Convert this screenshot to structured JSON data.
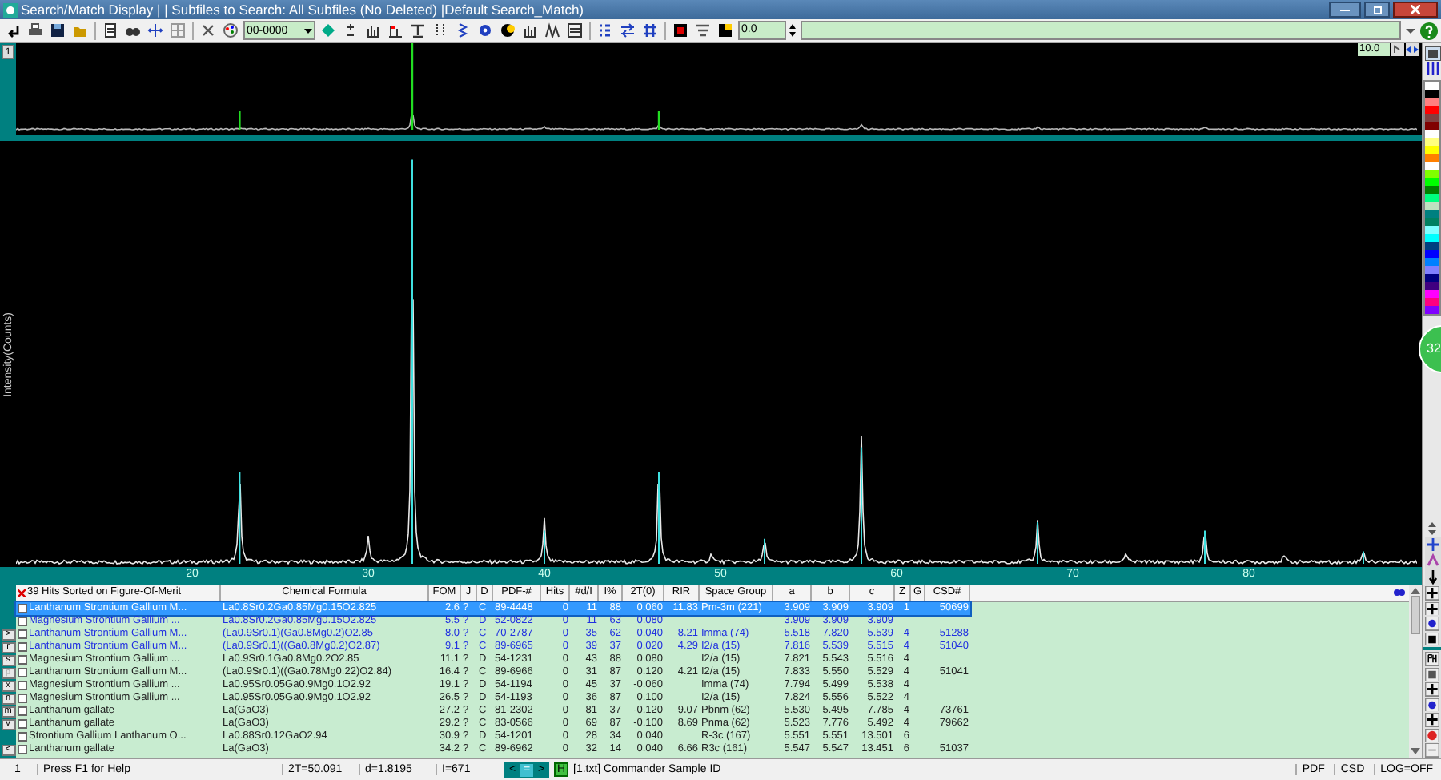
{
  "window": {
    "title": "Search/Match Display | | Subfiles to Search: All Subfiles (No Deleted) |Default Search_Match)"
  },
  "toolbar": {
    "pdf_combo": "00-0000",
    "offset_field": "0.0"
  },
  "upper_plot": {
    "pane_button": "1",
    "scale_field": "10.0"
  },
  "main_plot": {
    "ylabel": "Intensity(Counts)",
    "x_axis_labels": [
      "20",
      "30",
      "40",
      "50",
      "60",
      "70",
      "80"
    ],
    "badge": "32"
  },
  "palette": [
    {
      "color": "#ffffff"
    },
    {
      "color": "#000000"
    },
    {
      "color": "#ff8080"
    },
    {
      "color": "#ff0000"
    },
    {
      "color": "#804040"
    },
    {
      "color": "#800000"
    },
    {
      "color": "#ffffff"
    },
    {
      "color": "#ffff80"
    },
    {
      "color": "#ffff00"
    },
    {
      "color": "#ff8000"
    },
    {
      "color": "#ffffff"
    },
    {
      "color": "#80ff00"
    },
    {
      "color": "#00ff00"
    },
    {
      "color": "#008000"
    },
    {
      "color": "#00ff80"
    },
    {
      "color": "#c0e0c0"
    },
    {
      "color": "#008080"
    },
    {
      "color": "#008060"
    },
    {
      "color": "#80ffff"
    },
    {
      "color": "#00ffff"
    },
    {
      "color": "#004080"
    },
    {
      "color": "#0000ff"
    },
    {
      "color": "#0080ff"
    },
    {
      "color": "#8080ff"
    },
    {
      "color": "#000080"
    },
    {
      "color": "#400080"
    },
    {
      "color": "#ff00ff"
    },
    {
      "color": "#ff0080"
    },
    {
      "color": "#8000ff"
    }
  ],
  "side_buttons": [
    ">",
    "r",
    "s",
    "p",
    "x",
    "n",
    "m",
    "v",
    "<"
  ],
  "table": {
    "columns": [
      "39 Hits Sorted on Figure-Of-Merit",
      "Chemical Formula",
      "FOM",
      "J",
      "D",
      "PDF-#",
      "Hits",
      "#d/I",
      "I%",
      "2T(0)",
      "RIR",
      "Space Group",
      "a",
      "b",
      "c",
      "Z",
      "G",
      "CSD#"
    ],
    "rows": [
      {
        "selected": true,
        "highlighted": true,
        "checked": false,
        "cells": [
          "Lanthanum Strontium Gallium M...",
          "La0.8Sr0.2Ga0.85Mg0.15O2.825",
          "2.6",
          "?",
          "C",
          "89-4448",
          "0",
          "11",
          "88",
          "0.060",
          "11.83",
          "Pm-3m (221)",
          "3.909",
          "3.909",
          "3.909",
          "1",
          "",
          "50699"
        ]
      },
      {
        "selected": false,
        "highlighted": true,
        "checked": false,
        "cells": [
          "Magnesium Strontium Gallium ...",
          "La0.8Sr0.2Ga0.85Mg0.15O2.825",
          "5.5",
          "?",
          "D",
          "52-0822",
          "0",
          "11",
          "63",
          "0.080",
          "",
          "",
          "3.909",
          "3.909",
          "3.909",
          "",
          "",
          ""
        ]
      },
      {
        "selected": false,
        "highlighted": true,
        "checked": false,
        "cells": [
          "Lanthanum Strontium Gallium M...",
          "(La0.9Sr0.1)(Ga0.8Mg0.2)O2.85",
          "8.0",
          "?",
          "C",
          "70-2787",
          "0",
          "35",
          "62",
          "0.040",
          "8.21",
          "Imma (74)",
          "5.518",
          "7.820",
          "5.539",
          "4",
          "",
          "51288"
        ]
      },
      {
        "selected": false,
        "highlighted": true,
        "checked": false,
        "cells": [
          "Lanthanum Strontium Gallium M...",
          "(La0.9Sr0.1)((Ga0.8Mg0.2)O2.87)",
          "9.1",
          "?",
          "C",
          "89-6965",
          "0",
          "39",
          "37",
          "0.020",
          "4.29",
          "I2/a (15)",
          "7.816",
          "5.539",
          "5.515",
          "4",
          "",
          "51040"
        ]
      },
      {
        "selected": false,
        "highlighted": false,
        "checked": false,
        "cells": [
          "Magnesium Strontium Gallium ...",
          "La0.9Sr0.1Ga0.8Mg0.2O2.85",
          "11.1",
          "?",
          "D",
          "54-1231",
          "0",
          "43",
          "88",
          "0.080",
          "",
          "I2/a (15)",
          "7.821",
          "5.543",
          "5.516",
          "4",
          "",
          ""
        ]
      },
      {
        "selected": false,
        "highlighted": false,
        "checked": false,
        "cells": [
          "Lanthanum Strontium Gallium M...",
          "(La0.9Sr0.1)((Ga0.78Mg0.22)O2.84)",
          "16.4",
          "?",
          "C",
          "89-6966",
          "0",
          "31",
          "87",
          "0.120",
          "4.21",
          "I2/a (15)",
          "7.833",
          "5.550",
          "5.529",
          "4",
          "",
          "51041"
        ]
      },
      {
        "selected": false,
        "highlighted": false,
        "checked": false,
        "cells": [
          "Magnesium Strontium Gallium ...",
          "La0.95Sr0.05Ga0.9Mg0.1O2.92",
          "19.1",
          "?",
          "D",
          "54-1194",
          "0",
          "45",
          "37",
          "-0.060",
          "",
          "Imma (74)",
          "7.794",
          "5.499",
          "5.538",
          "4",
          "",
          ""
        ]
      },
      {
        "selected": false,
        "highlighted": false,
        "checked": false,
        "cells": [
          "Magnesium Strontium Gallium ...",
          "La0.95Sr0.05Ga0.9Mg0.1O2.92",
          "26.5",
          "?",
          "D",
          "54-1193",
          "0",
          "36",
          "87",
          "0.100",
          "",
          "I2/a (15)",
          "7.824",
          "5.556",
          "5.522",
          "4",
          "",
          ""
        ]
      },
      {
        "selected": false,
        "highlighted": false,
        "checked": false,
        "cells": [
          "Lanthanum gallate",
          "La(GaO3)",
          "27.2",
          "?",
          "C",
          "81-2302",
          "0",
          "81",
          "37",
          "-0.120",
          "9.07",
          "Pbnm (62)",
          "5.530",
          "5.495",
          "7.785",
          "4",
          "",
          "73761"
        ]
      },
      {
        "selected": false,
        "highlighted": false,
        "checked": false,
        "cells": [
          "Lanthanum gallate",
          "La(GaO3)",
          "29.2",
          "?",
          "C",
          "83-0566",
          "0",
          "69",
          "87",
          "-0.100",
          "8.69",
          "Pnma (62)",
          "5.523",
          "7.776",
          "5.492",
          "4",
          "",
          "79662"
        ]
      },
      {
        "selected": false,
        "highlighted": false,
        "checked": false,
        "cells": [
          "Strontium Gallium Lanthanum O...",
          "La0.88Sr0.12GaO2.94",
          "30.9",
          "?",
          "D",
          "54-1201",
          "0",
          "28",
          "34",
          "0.040",
          "",
          "R-3c (167)",
          "5.551",
          "5.551",
          "13.501",
          "6",
          "",
          ""
        ]
      },
      {
        "selected": false,
        "highlighted": false,
        "checked": false,
        "cells": [
          "Lanthanum gallate",
          "La(GaO3)",
          "34.2",
          "?",
          "C",
          "89-6962",
          "0",
          "32",
          "14",
          "0.040",
          "6.66",
          "R3c (161)",
          "5.547",
          "5.547",
          "13.451",
          "6",
          "",
          "51037"
        ]
      }
    ]
  },
  "status_bar": {
    "pane": "1",
    "help": "Press F1 for Help",
    "two_theta": "2T=50.091",
    "d_spacing": "d=1.8195",
    "intensity": "I=671",
    "nav": [
      "<",
      "=",
      ">"
    ],
    "h_button": "H",
    "sample": "[1.txt] Commander Sample ID",
    "indicators": [
      "PDF",
      "CSD",
      "LOG=OFF"
    ]
  }
}
